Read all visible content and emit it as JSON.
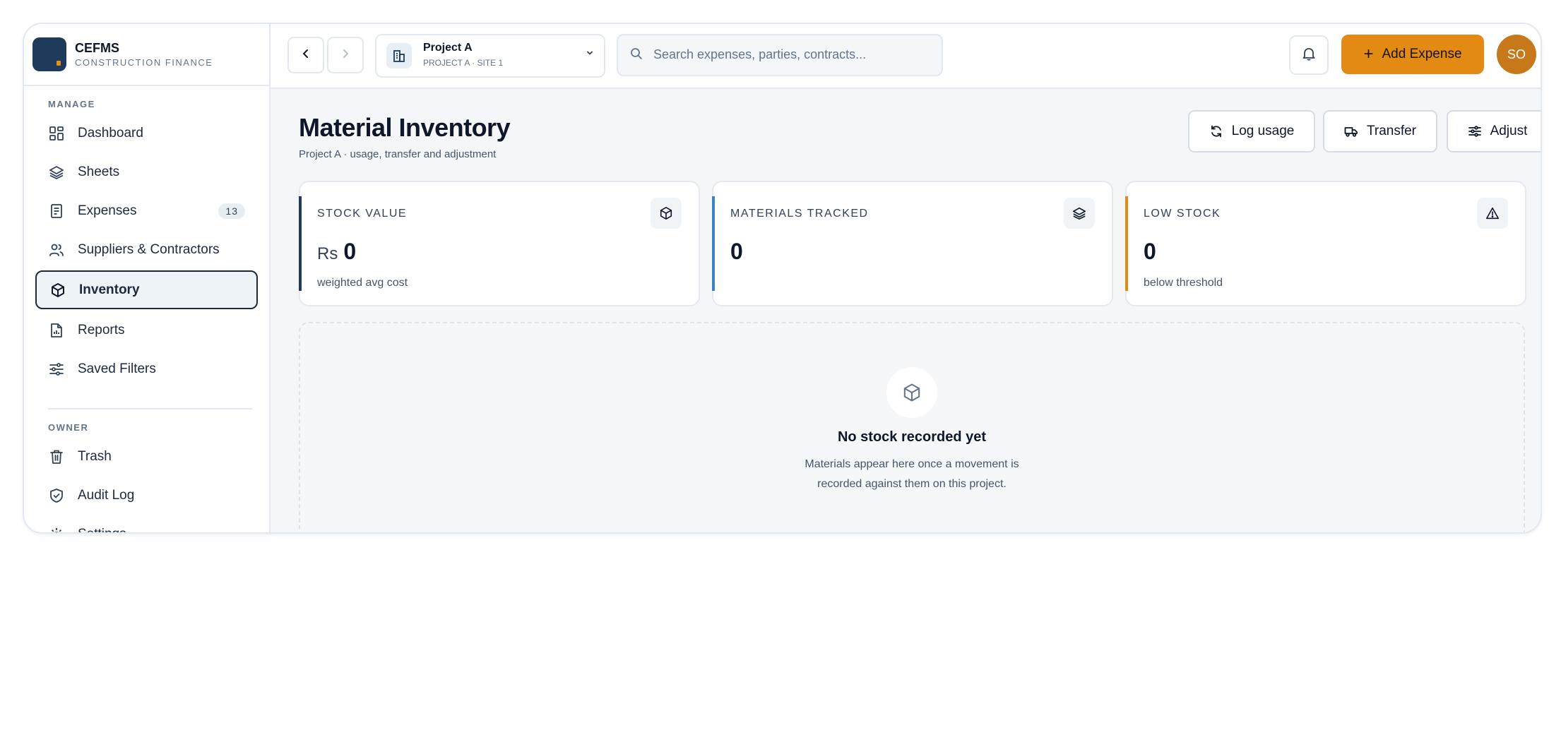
{
  "brand": {
    "name": "CEFMS",
    "subtitle": "CONSTRUCTION FINANCE"
  },
  "sidebar": {
    "sections": [
      {
        "label": "MANAGE"
      },
      {
        "label": "OWNER"
      }
    ],
    "manage_items": [
      {
        "label": "Dashboard",
        "icon": "dashboard-icon"
      },
      {
        "label": "Sheets",
        "icon": "layers-icon"
      },
      {
        "label": "Expenses",
        "icon": "receipt-icon",
        "badge": "13"
      },
      {
        "label": "Suppliers & Contractors",
        "icon": "users-icon"
      },
      {
        "label": "Inventory",
        "icon": "box-icon",
        "active": true
      },
      {
        "label": "Reports",
        "icon": "report-icon"
      },
      {
        "label": "Saved Filters",
        "icon": "sliders-icon"
      }
    ],
    "owner_items": [
      {
        "label": "Trash",
        "icon": "trash-icon"
      },
      {
        "label": "Audit Log",
        "icon": "shield-icon"
      },
      {
        "label": "Settings",
        "icon": "gear-icon"
      }
    ]
  },
  "topbar": {
    "project": {
      "name": "Project A",
      "sub": "PROJECT A · SITE 1"
    },
    "search_placeholder": "Search expenses, parties, contracts...",
    "add_button": "Add Expense",
    "avatar_initials": "SO"
  },
  "page": {
    "title": "Material Inventory",
    "subtitle": "Project A · usage, transfer and adjustment",
    "actions": {
      "log_usage": "Log usage",
      "transfer": "Transfer",
      "adjust": "Adjust"
    }
  },
  "stats": [
    {
      "label": "STOCK VALUE",
      "currency": "Rs",
      "value": "0",
      "sub": "weighted avg cost",
      "accent": "#1f3b5c"
    },
    {
      "label": "MATERIALS TRACKED",
      "value": "0",
      "sub": "",
      "accent": "#3b82c4"
    },
    {
      "label": "LOW STOCK",
      "value": "0",
      "sub": "below threshold",
      "accent": "#e28a14"
    }
  ],
  "empty_state": {
    "title": "No stock recorded yet",
    "line1": "Materials appear here once a movement is",
    "line2": "recorded against them on this project."
  },
  "colors": {
    "accent": "#e28a14",
    "brand": "#1f3b5c",
    "avatar": "#c7781a"
  }
}
